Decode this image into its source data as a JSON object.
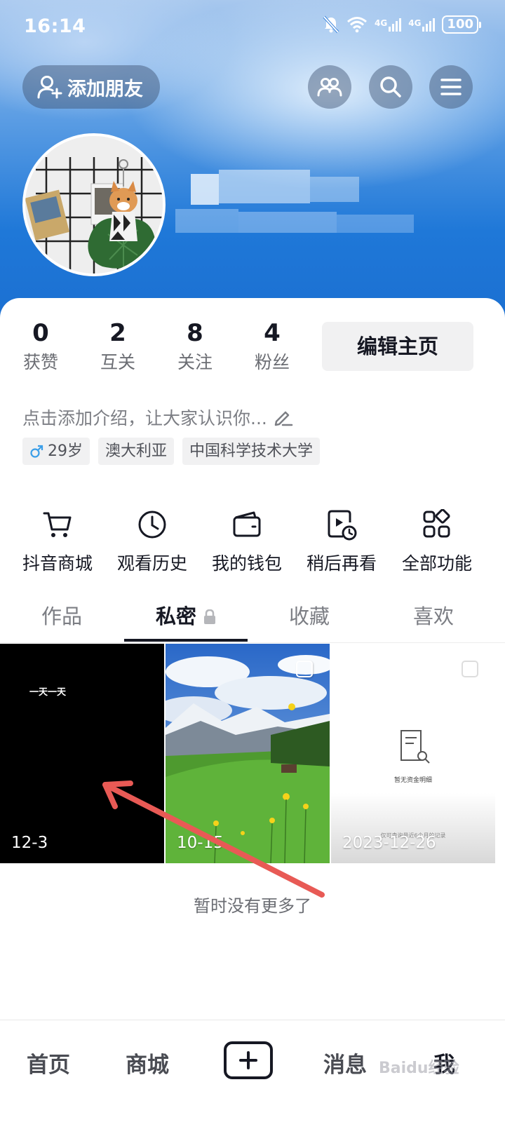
{
  "status_bar": {
    "time": "16:14",
    "battery": "100",
    "network_labels": [
      "4G",
      "4G"
    ]
  },
  "header": {
    "add_friend_label": "添加朋友"
  },
  "stats": [
    {
      "number": "0",
      "label": "获赞"
    },
    {
      "number": "2",
      "label": "互关"
    },
    {
      "number": "8",
      "label": "关注"
    },
    {
      "number": "4",
      "label": "粉丝"
    }
  ],
  "edit_profile_label": "编辑主页",
  "bio": {
    "placeholder": "点击添加介绍，让大家认识你..."
  },
  "tags": {
    "age": "29岁",
    "location": "澳大利亚",
    "school": "中国科学技术大学"
  },
  "shortcuts": [
    {
      "label": "抖音商城",
      "icon": "cart-icon"
    },
    {
      "label": "观看历史",
      "icon": "clock-icon"
    },
    {
      "label": "我的钱包",
      "icon": "wallet-icon"
    },
    {
      "label": "稍后再看",
      "icon": "watch-later-icon"
    },
    {
      "label": "全部功能",
      "icon": "grid-icon"
    }
  ],
  "tabs": [
    {
      "label": "作品"
    },
    {
      "label": "私密"
    },
    {
      "label": "收藏"
    },
    {
      "label": "喜欢"
    }
  ],
  "active_tab": "私密",
  "videos": [
    {
      "date": "12-3",
      "overlay_text": "一天一天"
    },
    {
      "date": "10-15"
    },
    {
      "date": "2023-12-26",
      "overlay_text": "暂无资金明细",
      "overlay_subtext": "仅可查询最近6个月的记录"
    }
  ],
  "no_more_text": "暂时没有更多了",
  "bottom_nav": {
    "home": "首页",
    "mall": "商城",
    "messages": "消息",
    "me": "我"
  },
  "watermark": "Baidu经验",
  "colors": {
    "header_blue": "#1f78d8",
    "arrow_red": "#e85a55",
    "text_primary": "#161823",
    "text_secondary": "#7c7e84"
  }
}
